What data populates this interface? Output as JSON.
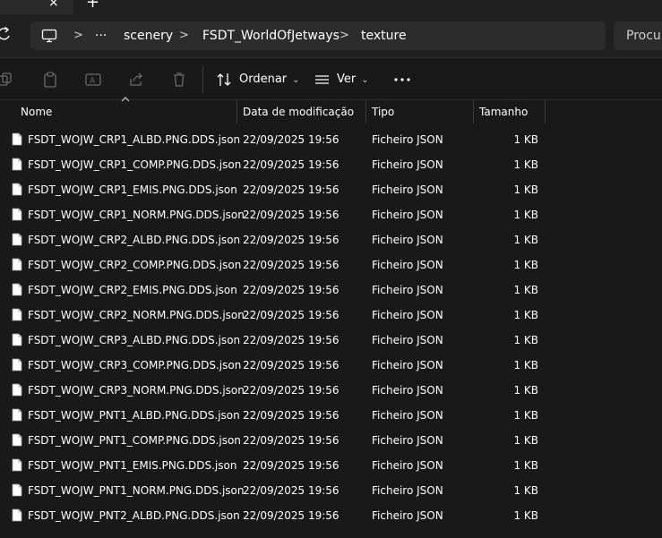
{
  "tab": {
    "close_glyph": "×",
    "new_glyph": "+"
  },
  "address": {
    "ellipsis": "···",
    "crumbs": [
      "scenery",
      "FSDT_WorldOfJetways",
      "texture"
    ],
    "chevron": ">"
  },
  "search": {
    "placeholder": "Procurar"
  },
  "toolbar": {
    "sort_label": "Ordenar",
    "view_label": "Ver",
    "icons": [
      "copy-icon",
      "paste-icon",
      "rename-icon",
      "share-icon",
      "delete-icon",
      "sort-icon",
      "view-icon",
      "more-icon"
    ]
  },
  "columns": {
    "name": "Nome",
    "date": "Data de modificação",
    "type": "Tipo",
    "size": "Tamanho"
  },
  "files": [
    {
      "name": "FSDT_WOJW_CRP1_ALBD.PNG.DDS.json",
      "date": "22/09/2025 19:56",
      "type": "Ficheiro JSON",
      "size": "1 KB"
    },
    {
      "name": "FSDT_WOJW_CRP1_COMP.PNG.DDS.json",
      "date": "22/09/2025 19:56",
      "type": "Ficheiro JSON",
      "size": "1 KB"
    },
    {
      "name": "FSDT_WOJW_CRP1_EMIS.PNG.DDS.json",
      "date": "22/09/2025 19:56",
      "type": "Ficheiro JSON",
      "size": "1 KB"
    },
    {
      "name": "FSDT_WOJW_CRP1_NORM.PNG.DDS.json",
      "date": "22/09/2025 19:56",
      "type": "Ficheiro JSON",
      "size": "1 KB"
    },
    {
      "name": "FSDT_WOJW_CRP2_ALBD.PNG.DDS.json",
      "date": "22/09/2025 19:56",
      "type": "Ficheiro JSON",
      "size": "1 KB"
    },
    {
      "name": "FSDT_WOJW_CRP2_COMP.PNG.DDS.json",
      "date": "22/09/2025 19:56",
      "type": "Ficheiro JSON",
      "size": "1 KB"
    },
    {
      "name": "FSDT_WOJW_CRP2_EMIS.PNG.DDS.json",
      "date": "22/09/2025 19:56",
      "type": "Ficheiro JSON",
      "size": "1 KB"
    },
    {
      "name": "FSDT_WOJW_CRP2_NORM.PNG.DDS.json",
      "date": "22/09/2025 19:56",
      "type": "Ficheiro JSON",
      "size": "1 KB"
    },
    {
      "name": "FSDT_WOJW_CRP3_ALBD.PNG.DDS.json",
      "date": "22/09/2025 19:56",
      "type": "Ficheiro JSON",
      "size": "1 KB"
    },
    {
      "name": "FSDT_WOJW_CRP3_COMP.PNG.DDS.json",
      "date": "22/09/2025 19:56",
      "type": "Ficheiro JSON",
      "size": "1 KB"
    },
    {
      "name": "FSDT_WOJW_CRP3_NORM.PNG.DDS.json",
      "date": "22/09/2025 19:56",
      "type": "Ficheiro JSON",
      "size": "1 KB"
    },
    {
      "name": "FSDT_WOJW_PNT1_ALBD.PNG.DDS.json",
      "date": "22/09/2025 19:56",
      "type": "Ficheiro JSON",
      "size": "1 KB"
    },
    {
      "name": "FSDT_WOJW_PNT1_COMP.PNG.DDS.json",
      "date": "22/09/2025 19:56",
      "type": "Ficheiro JSON",
      "size": "1 KB"
    },
    {
      "name": "FSDT_WOJW_PNT1_EMIS.PNG.DDS.json",
      "date": "22/09/2025 19:56",
      "type": "Ficheiro JSON",
      "size": "1 KB"
    },
    {
      "name": "FSDT_WOJW_PNT1_NORM.PNG.DDS.json",
      "date": "22/09/2025 19:56",
      "type": "Ficheiro JSON",
      "size": "1 KB"
    },
    {
      "name": "FSDT_WOJW_PNT2_ALBD.PNG.DDS.json",
      "date": "22/09/2025 19:56",
      "type": "Ficheiro JSON",
      "size": "1 KB"
    }
  ]
}
